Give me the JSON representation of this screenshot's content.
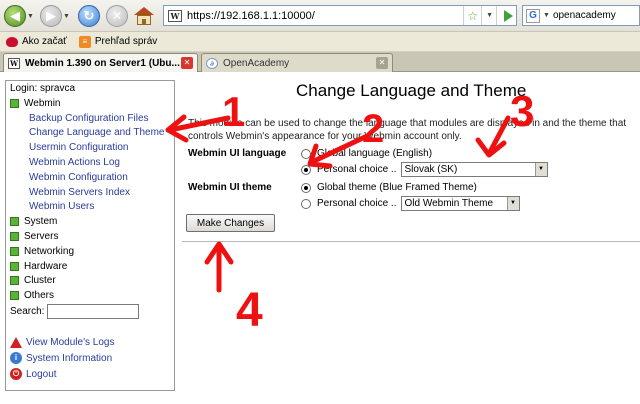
{
  "browser": {
    "url": "https://192.168.1.1:10000/",
    "search_value": "openacademy",
    "search_engine_glyph": "G",
    "bookmarks": [
      {
        "label": "Ako začať",
        "icon": "ladybug-icon"
      },
      {
        "label": "Prehľad správ",
        "icon": "rss-icon"
      }
    ],
    "tabs": [
      {
        "label": "Webmin 1.390 on Server1 (Ubu...",
        "active": true
      },
      {
        "label": "OpenAcademy",
        "active": false
      }
    ]
  },
  "sidebar": {
    "login": "Login: spravca",
    "category_webmin": "Webmin",
    "webmin_modules": [
      "Backup Configuration Files",
      "Change Language and Theme",
      "Usermin Configuration",
      "Webmin Actions Log",
      "Webmin Configuration",
      "Webmin Servers Index",
      "Webmin Users"
    ],
    "categories": [
      "System",
      "Servers",
      "Networking",
      "Hardware",
      "Cluster",
      "Others"
    ],
    "search_label": "Search:",
    "links": [
      "View Module's Logs",
      "System Information",
      "Logout"
    ]
  },
  "main": {
    "title": "Change Language and Theme",
    "intro_line1": "This module can be used to change the language that modules are displayed in and the theme that",
    "intro_line2": "controls Webmin's appearance for your Webmin account only.",
    "language_label": "Webmin UI language",
    "language_global": "Global language (English)",
    "language_personal": "Personal choice ..",
    "language_selected": "Slovak (SK)",
    "theme_label": "Webmin UI theme",
    "theme_global": "Global theme (Blue Framed Theme)",
    "theme_personal": "Personal choice ..",
    "theme_selected": "Old Webmin Theme",
    "submit_label": "Make Changes"
  },
  "annotations": [
    "1",
    "2",
    "3",
    "4"
  ],
  "colors": {
    "annotation": "#ee1111",
    "link": "#2a3c9a",
    "category_icon": "#5db23d"
  }
}
